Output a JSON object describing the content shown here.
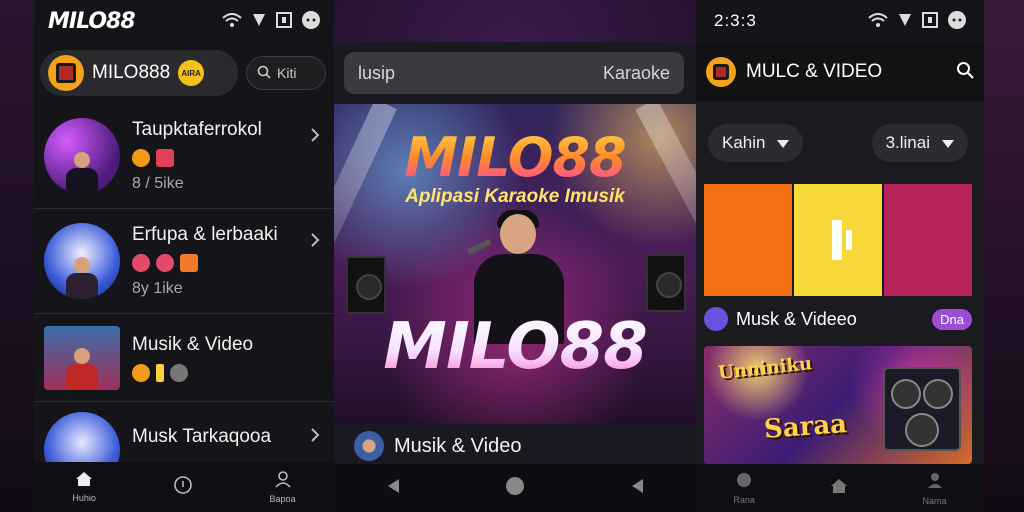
{
  "phone1": {
    "logo": "MILO88",
    "app_title": "MILO888",
    "app_badge": "AIRA",
    "search_text": "Kiti",
    "items": [
      {
        "title": "Taupktaferrokol",
        "sub": "8 / 5ike"
      },
      {
        "title": "Erfupa & lerbaaki",
        "sub": "8y 1ike"
      },
      {
        "title": "Musik & Video",
        "sub": ""
      },
      {
        "title": "Musk Tarkaqooa",
        "sub": ""
      }
    ],
    "nav": {
      "home": "Huhio",
      "center": "",
      "profile": "Bapoa"
    }
  },
  "phone2": {
    "search_left": "lusip",
    "search_right": "Karaoke",
    "banner_title_top": "MILO88",
    "banner_sub": "Aplipasi Karaoke Imusik",
    "banner_title_bottom": "MILO88",
    "row_label": "Musik & Video"
  },
  "phone3": {
    "time": "2:3:3",
    "title": "MULC & VIDEO",
    "filter_left": "Kahin",
    "filter_right": "3.linai",
    "row_label": "Musk & Videeo",
    "tag": "Dna",
    "card_text_top": "Unniniku",
    "card_text_bottom": "Saraa",
    "nav": {
      "left": "Rana",
      "center": "",
      "right": "Nama"
    }
  },
  "colors": {
    "tile_orange": "#f36f12",
    "tile_yellow": "#f6d838",
    "tile_magenta": "#b8235a",
    "accent_purple": "#9b4dd8"
  }
}
